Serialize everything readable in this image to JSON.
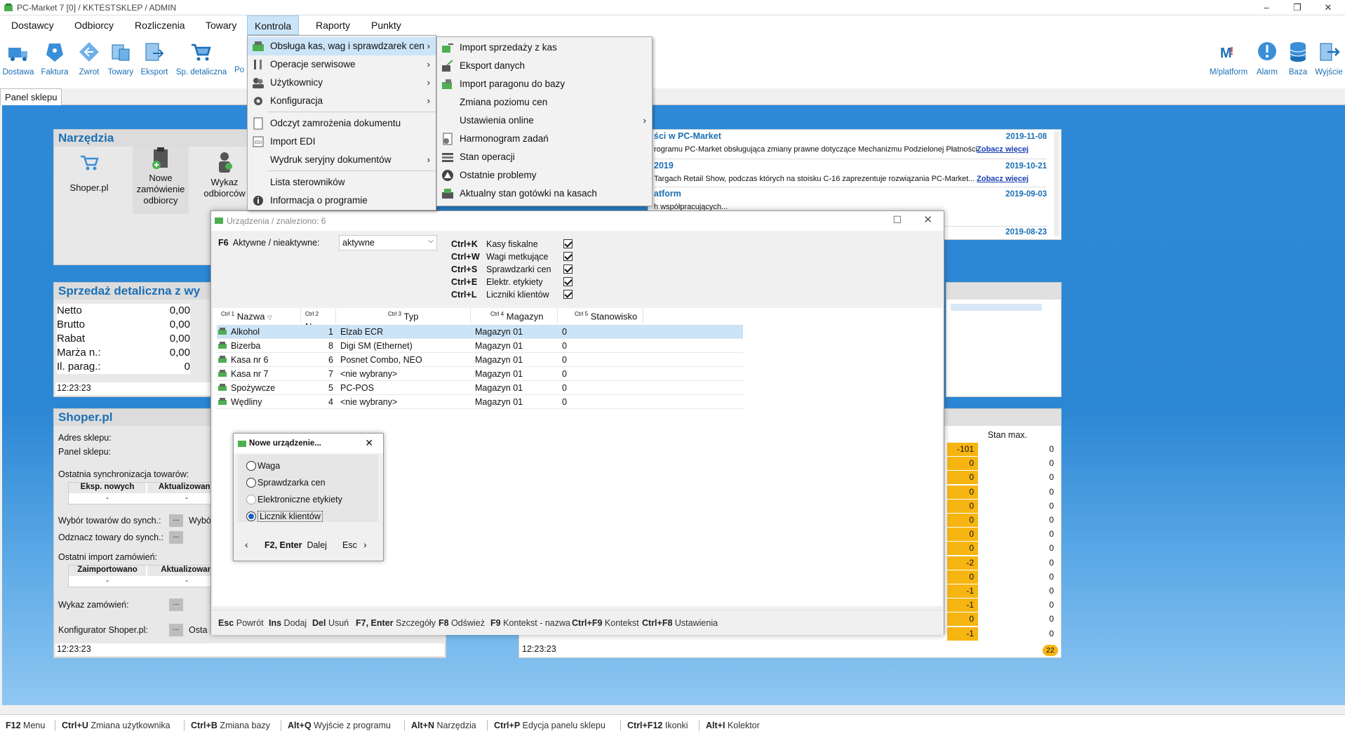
{
  "window": {
    "title": "PC-Market 7 [0] / KKTESTSKLEP / ADMIN"
  },
  "menubar": {
    "items": [
      "Dostawcy",
      "Odbiorcy",
      "Rozliczenia",
      "Towary",
      "Kontrola",
      "Raporty",
      "Punkty"
    ]
  },
  "toolbar": {
    "left": [
      {
        "label": "Dostawa",
        "icon": "truck-icon"
      },
      {
        "label": "Faktura",
        "icon": "invoice-icon"
      },
      {
        "label": "Zwrot",
        "icon": "return-icon"
      },
      {
        "label": "Towary",
        "icon": "goods-icon"
      },
      {
        "label": "Eksport",
        "icon": "export-icon"
      },
      {
        "label": "Sp. detaliczna",
        "icon": "cart-icon"
      },
      {
        "label": "Po"
      }
    ],
    "right": [
      {
        "label": "M/platform",
        "icon": "mplatform-icon"
      },
      {
        "label": "Alarm",
        "icon": "alarm-icon"
      },
      {
        "label": "Baza",
        "icon": "database-icon"
      },
      {
        "label": "Wyjście",
        "icon": "exit-icon"
      }
    ]
  },
  "tab": {
    "label": "Panel sklepu"
  },
  "kontrola_menu": {
    "items": [
      {
        "label": "Obsługa kas, wag i sprawdzarek cen",
        "submenu": true,
        "highlighted": true
      },
      {
        "label": "Operacje serwisowe",
        "submenu": true
      },
      {
        "label": "Użytkownicy",
        "submenu": true
      },
      {
        "label": "Konfiguracja",
        "submenu": true
      },
      {
        "label": "Odczyt zamrożenia dokumentu"
      },
      {
        "label": "Import EDI"
      },
      {
        "label": "Wydruk seryjny dokumentów",
        "submenu": true
      },
      {
        "label": "Lista sterowników"
      },
      {
        "label": "Informacja o programie"
      }
    ]
  },
  "submenu": {
    "items": [
      {
        "label": "Import sprzedaży z kas"
      },
      {
        "label": "Eksport danych"
      },
      {
        "label": "Import paragonu do bazy"
      },
      {
        "label": "Zmiana poziomu cen"
      },
      {
        "label": "Ustawienia online",
        "submenu": true
      },
      {
        "label": "Harmonogram zadań"
      },
      {
        "label": "Stan operacji"
      },
      {
        "label": "Ostatnie problemy"
      },
      {
        "label": "Aktualny stan gotówki na kasach"
      }
    ]
  },
  "narzedzia": {
    "title": "Narzędzia",
    "tools": [
      {
        "label": "Shoper.pl"
      },
      {
        "label": "Nowe zamówienie odbiorcy"
      },
      {
        "label": "Wykaz odbiorców"
      }
    ]
  },
  "sprzedaz": {
    "title": "Sprzedaż detaliczna z wy",
    "rows": [
      {
        "label": "Netto",
        "value": "0,00"
      },
      {
        "label": "Brutto",
        "value": "0,00"
      },
      {
        "label": "Rabat",
        "value": "0,00"
      },
      {
        "label": "Marża n.:",
        "value": "0,00"
      },
      {
        "label": "Il. parag.:",
        "value": "0"
      }
    ],
    "time": "12:23:23"
  },
  "shoper": {
    "title": "Shoper.pl",
    "adres": "Adres sklepu:",
    "panel": "Panel sklepu:",
    "sync_label": "Ostatnia synchronizacja towarów:",
    "sync_cols": [
      "Eksp. nowych",
      "Aktualizowany"
    ],
    "sync_vals": [
      "-",
      "-"
    ],
    "wybor": "Wybór towarów do synch.:",
    "wybor2": "Wybó",
    "odznacz": "Odznacz towary do synch.:",
    "import_label": "Ostatni import zamówień:",
    "import_cols": [
      "Zaimportowano",
      "Aktualizowan"
    ],
    "import_vals": [
      "-",
      "-"
    ],
    "wykaz": "Wykaz zamówień:",
    "konfig": "Konfigurator Shoper.pl:",
    "konfig2": "Osta",
    "dots": "...",
    "time": "12:23:23"
  },
  "news": {
    "items": [
      {
        "title": "ści w PC-Market",
        "date": "2019-11-08",
        "text": "rogramu PC-Market obsługująca zmiany prawne dotyczące Mechanizmu Podzielonej Płatności...",
        "link": "Zobacz więcej"
      },
      {
        "title": "2019",
        "date": "2019-10-21",
        "text": "Targach Retail Show, podczas których na stoisku C-16 zaprezentuje rozwiązania PC-Market...",
        "link": "Zobacz więcej"
      },
      {
        "title": "atform",
        "date": "2019-09-03",
        "text": "h współpracujących...",
        "link": ""
      },
      {
        "title": "",
        "date": "2019-08-23",
        "text": "",
        "link": ""
      }
    ]
  },
  "stock": {
    "header": "Stan max.",
    "left_vals": [
      "-101",
      "0",
      "0",
      "0",
      "0",
      "0",
      "0",
      "0",
      "-2",
      "0",
      "-1",
      "-1",
      "0",
      "-1"
    ],
    "right_vals": [
      "0",
      "0",
      "0",
      "0",
      "0",
      "0",
      "0",
      "0",
      "0",
      "0",
      "0",
      "0",
      "0",
      "0"
    ],
    "time": "12:23:23",
    "badge": "22"
  },
  "dialog": {
    "title": "Urządzenia / znaleziono: 6",
    "filter_key": "F6",
    "filter_label": "Aktywne / nieaktywne:",
    "filter_value": "aktywne",
    "checks": [
      {
        "key": "Ctrl+K",
        "label": "Kasy fiskalne",
        "checked": true
      },
      {
        "key": "Ctrl+W",
        "label": "Wagi metkujące",
        "checked": true
      },
      {
        "key": "Ctrl+S",
        "label": "Sprawdzarki cen",
        "checked": true
      },
      {
        "key": "Ctrl+E",
        "label": "Elektr. etykiety",
        "checked": true
      },
      {
        "key": "Ctrl+L",
        "label": "Liczniki klientów",
        "checked": true
      }
    ],
    "columns": [
      {
        "key": "Ctrl 1",
        "label": "Nazwa"
      },
      {
        "key": "Ctrl 2",
        "label": "Nume"
      },
      {
        "key": "Ctrl 3",
        "label": "Typ"
      },
      {
        "key": "Ctrl 4",
        "label": "Magazyn"
      },
      {
        "key": "Ctrl 5",
        "label": "Stanowisko"
      }
    ],
    "rows": [
      {
        "name": "Alkohol",
        "num": "1",
        "type": "Elzab ECR",
        "mag": "Magazyn 01",
        "stan": "0"
      },
      {
        "name": "Bizerba",
        "num": "8",
        "type": "Digi SM (Ethernet)",
        "mag": "Magazyn 01",
        "stan": "0"
      },
      {
        "name": "Kasa nr 6",
        "num": "6",
        "type": "Posnet Combo, NEO",
        "mag": "Magazyn 01",
        "stan": "0"
      },
      {
        "name": "Kasa nr 7",
        "num": "7",
        "type": "<nie wybrany>",
        "mag": "Magazyn 01",
        "stan": "0"
      },
      {
        "name": "Spożywcze",
        "num": "5",
        "type": "PC-POS",
        "mag": "Magazyn 01",
        "stan": "0"
      },
      {
        "name": "Wędliny",
        "num": "4",
        "type": "<nie wybrany>",
        "mag": "Magazyn 01",
        "stan": "0"
      }
    ],
    "footer": [
      {
        "key": "Esc",
        "label": "Powrót"
      },
      {
        "key": "Ins",
        "label": "Dodaj"
      },
      {
        "key": "Del",
        "label": "Usuń"
      },
      {
        "key": "F7, Enter",
        "label": "Szczegóły"
      },
      {
        "key": "F8",
        "label": "Odśwież"
      },
      {
        "key": "F9",
        "label": "Kontekst - nazwa"
      },
      {
        "key": "Ctrl+F9",
        "label": "Kontekst"
      },
      {
        "key": "Ctrl+F8",
        "label": "Ustawienia"
      }
    ]
  },
  "subdialog": {
    "title": "Nowe urządzenie...",
    "options": [
      {
        "label": "Waga",
        "checked": false
      },
      {
        "label": "Sprawdzarka cen",
        "checked": false
      },
      {
        "label": "Elektroniczne etykiety",
        "checked": false
      },
      {
        "label": "Licznik klientów",
        "checked": true
      }
    ],
    "next_key": "F2, Enter",
    "next_label": "Dalej",
    "esc": "Esc"
  },
  "statusbar": {
    "items": [
      {
        "key": "F12",
        "label": "Menu"
      },
      {
        "key": "Ctrl+U",
        "label": "Zmiana użytkownika"
      },
      {
        "key": "Ctrl+B",
        "label": "Zmiana bazy"
      },
      {
        "key": "Alt+Q",
        "label": "Wyjście z programu"
      },
      {
        "key": "Alt+N",
        "label": "Narzędzia"
      },
      {
        "key": "Ctrl+P",
        "label": "Edycja panelu sklepu"
      },
      {
        "key": "Ctrl+F12",
        "label": "Ikonki"
      },
      {
        "key": "Alt+I",
        "label": "Kolektor"
      }
    ]
  },
  "colors": {
    "accent": "#1a6fb5",
    "highlight": "#cce4f7",
    "warning": "#f7b512"
  }
}
